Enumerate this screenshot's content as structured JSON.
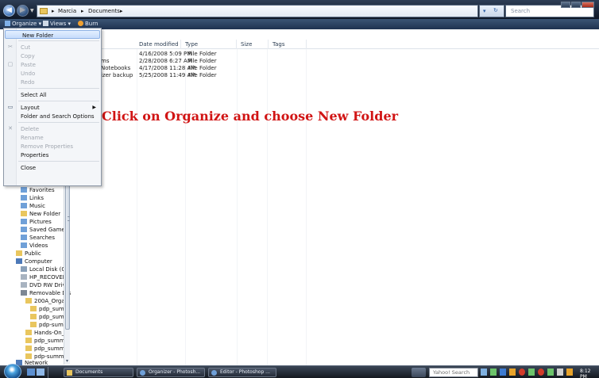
{
  "window": {
    "breadcrumbs": [
      "Marcia",
      "Documents"
    ],
    "search_placeholder": "Search"
  },
  "toolbar": {
    "organize_label": "Organize",
    "views_label": "Views",
    "burn_label": "Burn"
  },
  "file_list": {
    "columns": [
      "Date modified",
      "Type",
      "Size",
      "Tags"
    ],
    "rows": [
      {
        "name": "",
        "date": "4/16/2008 5:09 PM",
        "type": "File Folder"
      },
      {
        "name": "ms",
        "date": "2/28/2008 6:27 AM",
        "type": "File Folder"
      },
      {
        "name": "Notebooks",
        "date": "4/17/2008 11:28 AM",
        "type": "File Folder"
      },
      {
        "name": "izer backup",
        "date": "5/25/2008 11:49 AM",
        "type": "File Folder"
      }
    ]
  },
  "annotation": "Click on Organize and choose New Folder",
  "menu": {
    "new_folder": "New Folder",
    "cut": "Cut",
    "copy": "Copy",
    "paste": "Paste",
    "undo": "Undo",
    "redo": "Redo",
    "select_all": "Select All",
    "layout": "Layout",
    "folder_options": "Folder and Search Options",
    "delete": "Delete",
    "rename": "Rename",
    "remove_properties": "Remove Properties",
    "properties": "Properties",
    "close": "Close"
  },
  "nav_tree": [
    "Favorites",
    "Links",
    "Music",
    "New Folder",
    "Pictures",
    "Saved Games",
    "Searches",
    "Videos",
    "Public",
    "Computer",
    "Local Disk (C:)",
    "HP_RECOVERY",
    "DVD RW Drive",
    "Removable Dis",
    "200A_Organi",
    "pdp_summ",
    "pdp_summ",
    "pdp-summ",
    "Hands-On_B",
    "pdp_summe",
    "pdp_summe",
    "pdp-summe",
    "Network"
  ],
  "taskbar": {
    "buttons": [
      "Documents",
      "Organizer - Photosh...",
      "Editor - Photoshop ..."
    ],
    "yahoo_search": "Yahoo! Search",
    "clock": "8:12 PM"
  },
  "colors": {
    "annotation": "#d11414",
    "menu_highlight": "#c6dcfb",
    "folder": "#e9c65e"
  }
}
